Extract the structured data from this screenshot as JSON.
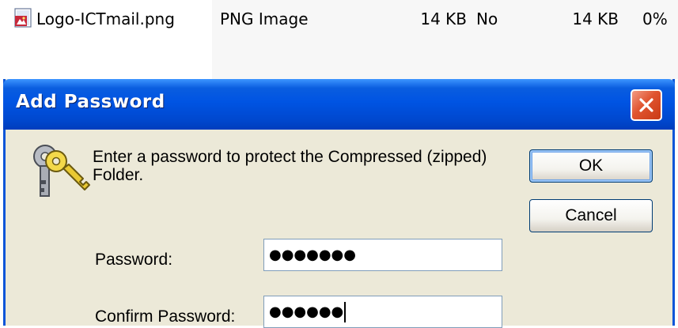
{
  "file_list": {
    "row": {
      "name": "Logo-ICTmail.png",
      "type": "PNG Image",
      "size": "14 KB",
      "encrypted": "No",
      "compressed_size": "14 KB",
      "ratio": "0%",
      "icon": "png-file-icon"
    }
  },
  "dialog": {
    "title": "Add Password",
    "icon": "keys-icon",
    "message": "Enter a password to protect the Compressed (zipped) Folder.",
    "ok_label": "OK",
    "cancel_label": "Cancel",
    "password_label": "Password:",
    "password_value": "●●●●●●●",
    "confirm_label": "Confirm Password:",
    "confirm_value": "●●●●●●"
  },
  "colors": {
    "titlebar": "#0054e3",
    "dialog_bg": "#ece9d8",
    "close_button": "#e0542f",
    "field_border": "#7f9db9"
  }
}
